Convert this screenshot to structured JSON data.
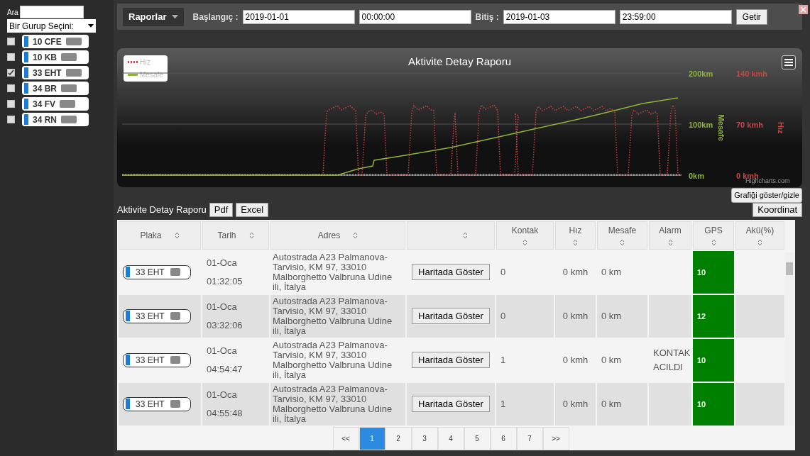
{
  "sidebar": {
    "search_label": "Ara",
    "group_select": "Bir Gurup Seçini:",
    "vehicles": [
      {
        "plate": "10 CFE",
        "checked": false
      },
      {
        "plate": "10 KB",
        "checked": false
      },
      {
        "plate": "33 EHT",
        "checked": true
      },
      {
        "plate": "34 BR",
        "checked": false
      },
      {
        "plate": "34 FV",
        "checked": false
      },
      {
        "plate": "34 RN",
        "checked": false
      }
    ]
  },
  "toolbar": {
    "menu": "Raporlar",
    "start_label": "Başlangıç :",
    "start_date": "2019-01-01",
    "start_time": "00:00:00",
    "end_label": "Bitiş :",
    "end_date": "2019-01-03",
    "end_time": "23:59:00",
    "submit": "Getir"
  },
  "chart": {
    "title": "Aktivite Detay Raporu",
    "legend": [
      {
        "name": "Hız",
        "color": "#cc4444"
      },
      {
        "name": "Mesafe",
        "color": "#8fb33a"
      }
    ],
    "left_ticks": [
      "200km",
      "100km",
      "0km"
    ],
    "left_title": "Mesafe",
    "right_ticks": [
      "140 kmh",
      "70 kmh",
      "0 kmh"
    ],
    "right_title": "Hız",
    "credit": "Highcharts.com",
    "toggle": "Grafiği göster/gizle"
  },
  "report": {
    "title": "Aktivite Detay Raporu",
    "exports": [
      "Pdf",
      "Excel"
    ],
    "coord_button": "Koordinat",
    "columns": [
      {
        "label": "Plaka"
      },
      {
        "label": "Tarih"
      },
      {
        "label": "Adres"
      },
      {
        "kind": "blank"
      },
      {
        "label": "Kontak"
      },
      {
        "label": "Hız"
      },
      {
        "label": "Mesafe"
      },
      {
        "label": "Alarm"
      },
      {
        "label": "GPS"
      },
      {
        "label": "Akü(%)"
      }
    ],
    "rows": [
      {
        "plate": "33 EHT",
        "date": "01-Oca",
        "time": "01:32:05",
        "address": "Autostrada A23 Palmanova-Tarvisio, KM 97, 33010 Malborghetto Valbruna Udine ili, İtalya",
        "map_button": "Haritada Göster",
        "contact": "0",
        "speed": "0 kmh",
        "distance": "0 km",
        "alarm": "",
        "gps": "10"
      },
      {
        "plate": "33 EHT",
        "date": "01-Oca",
        "time": "03:32:06",
        "address": "Autostrada A23 Palmanova-Tarvisio, KM 97, 33010 Malborghetto Valbruna Udine ili, İtalya",
        "map_button": "Haritada Göster",
        "contact": "0",
        "speed": "0 kmh",
        "distance": "0 km",
        "alarm": "",
        "gps": "12"
      },
      {
        "plate": "33 EHT",
        "date": "01-Oca",
        "time": "04:54:47",
        "address": "Autostrada A23 Palmanova-Tarvisio, KM 97, 33010 Malborghetto Valbruna Udine ili, İtalya",
        "map_button": "Haritada Göster",
        "contact": "1",
        "speed": "0 kmh",
        "distance": "0 km",
        "alarm": "KONTAK ACILDI",
        "gps": "10"
      },
      {
        "plate": "33 EHT",
        "date": "01-Oca",
        "time": "04:55:48",
        "address": "Autostrada A23 Palmanova-Tarvisio, KM 97, 33010 Malborghetto Valbruna Udine ili, İtalya",
        "map_button": "Haritada Göster",
        "contact": "1",
        "speed": "0 kmh",
        "distance": "0 km",
        "alarm": "",
        "gps": "10"
      }
    ],
    "pagination": [
      {
        "label": "<<",
        "selected": false
      },
      {
        "label": "1",
        "selected": true
      },
      {
        "label": "2",
        "selected": false
      },
      {
        "label": "3",
        "selected": false
      },
      {
        "label": "4",
        "selected": false
      },
      {
        "label": "5",
        "selected": false
      },
      {
        "label": "6",
        "selected": false
      },
      {
        "label": "7",
        "selected": false
      },
      {
        "label": ">>",
        "selected": false
      }
    ]
  }
}
